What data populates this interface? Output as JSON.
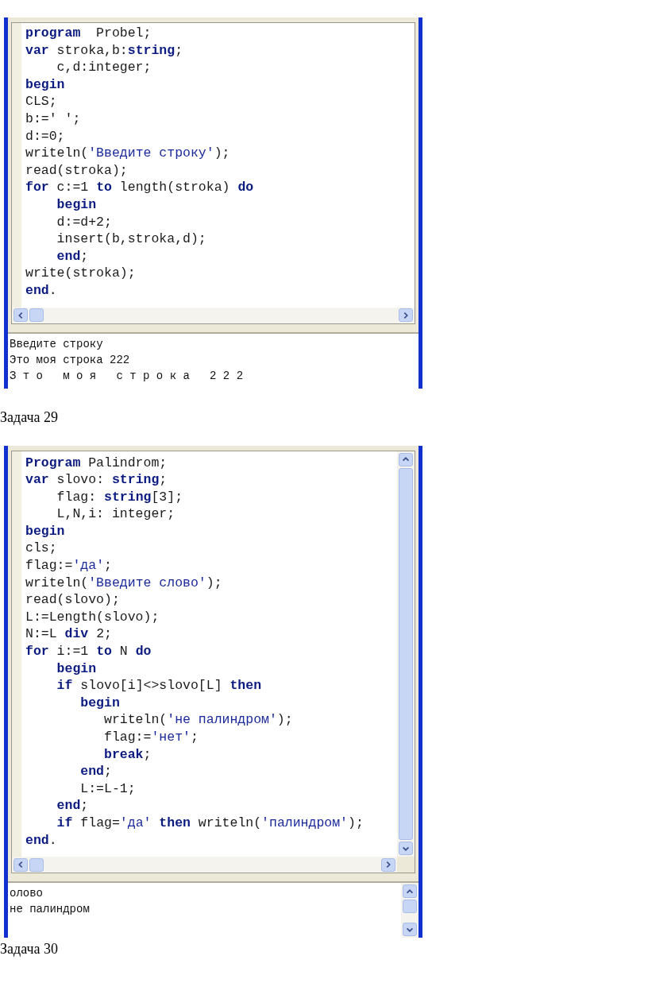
{
  "blocks": [
    {
      "editor": {
        "vertical_scrollbar": false,
        "lines": [
          [
            {
              "kind": "kw",
              "text": "program"
            },
            {
              "kind": "plain",
              "text": "  Probel;"
            }
          ],
          [
            {
              "kind": "kw",
              "text": "var"
            },
            {
              "kind": "plain",
              "text": " stroka,b:"
            },
            {
              "kind": "kw",
              "text": "string"
            },
            {
              "kind": "plain",
              "text": ";"
            }
          ],
          [
            {
              "kind": "plain",
              "text": "    c,d:integer;"
            }
          ],
          [
            {
              "kind": "kw",
              "text": "begin"
            }
          ],
          [
            {
              "kind": "plain",
              "text": "CLS;"
            }
          ],
          [
            {
              "kind": "plain",
              "text": "b:=' ';"
            }
          ],
          [
            {
              "kind": "plain",
              "text": "d:=0;"
            }
          ],
          [
            {
              "kind": "plain",
              "text": "writeln("
            },
            {
              "kind": "str",
              "text": "'Введите строку'"
            },
            {
              "kind": "plain",
              "text": ");"
            }
          ],
          [
            {
              "kind": "plain",
              "text": "read(stroka);"
            }
          ],
          [
            {
              "kind": "kw",
              "text": "for"
            },
            {
              "kind": "plain",
              "text": " c:=1 "
            },
            {
              "kind": "kw",
              "text": "to"
            },
            {
              "kind": "plain",
              "text": " length(stroka) "
            },
            {
              "kind": "kw",
              "text": "do"
            }
          ],
          [
            {
              "kind": "kw",
              "text": "    begin"
            }
          ],
          [
            {
              "kind": "plain",
              "text": "    d:=d+2;"
            }
          ],
          [
            {
              "kind": "plain",
              "text": "    insert(b,stroka,d);"
            }
          ],
          [
            {
              "kind": "kw",
              "text": "    end"
            },
            {
              "kind": "plain",
              "text": ";"
            }
          ],
          [
            {
              "kind": "plain",
              "text": "write(stroka);"
            }
          ],
          [
            {
              "kind": "kw",
              "text": "end"
            },
            {
              "kind": "plain",
              "text": "."
            }
          ]
        ]
      },
      "output": {
        "vertical_scrollbar": false,
        "lines": [
          "Введите строку",
          "Это моя строка 222",
          "З т о   м о я   с т р о к а   2 2 2"
        ]
      },
      "caption": "Задача 29"
    },
    {
      "editor": {
        "vertical_scrollbar": true,
        "lines": [
          [
            {
              "kind": "kw",
              "text": "Program"
            },
            {
              "kind": "plain",
              "text": " Palindrom;"
            }
          ],
          [
            {
              "kind": "kw",
              "text": "var"
            },
            {
              "kind": "plain",
              "text": " slovo: "
            },
            {
              "kind": "kw",
              "text": "string"
            },
            {
              "kind": "plain",
              "text": ";"
            }
          ],
          [
            {
              "kind": "plain",
              "text": "    flag: "
            },
            {
              "kind": "kw",
              "text": "string"
            },
            {
              "kind": "plain",
              "text": "[3];"
            }
          ],
          [
            {
              "kind": "plain",
              "text": "    L,N,i: integer;"
            }
          ],
          [
            {
              "kind": "kw",
              "text": "begin"
            }
          ],
          [
            {
              "kind": "plain",
              "text": "cls;"
            }
          ],
          [
            {
              "kind": "plain",
              "text": "flag:="
            },
            {
              "kind": "str",
              "text": "'да'"
            },
            {
              "kind": "plain",
              "text": ";"
            }
          ],
          [
            {
              "kind": "plain",
              "text": "writeln("
            },
            {
              "kind": "str",
              "text": "'Введите слово'"
            },
            {
              "kind": "plain",
              "text": ");"
            }
          ],
          [
            {
              "kind": "plain",
              "text": "read(slovo);"
            }
          ],
          [
            {
              "kind": "plain",
              "text": "L:=Length(slovo);"
            }
          ],
          [
            {
              "kind": "plain",
              "text": "N:=L "
            },
            {
              "kind": "kw",
              "text": "div"
            },
            {
              "kind": "plain",
              "text": " 2;"
            }
          ],
          [
            {
              "kind": "kw",
              "text": "for"
            },
            {
              "kind": "plain",
              "text": " i:=1 "
            },
            {
              "kind": "kw",
              "text": "to"
            },
            {
              "kind": "plain",
              "text": " N "
            },
            {
              "kind": "kw",
              "text": "do"
            }
          ],
          [
            {
              "kind": "kw",
              "text": "    begin"
            }
          ],
          [
            {
              "kind": "kw",
              "text": "    if"
            },
            {
              "kind": "plain",
              "text": " slovo[i]<>slovo[L] "
            },
            {
              "kind": "kw",
              "text": "then"
            }
          ],
          [
            {
              "kind": "kw",
              "text": "       begin"
            }
          ],
          [
            {
              "kind": "plain",
              "text": "          writeln("
            },
            {
              "kind": "str",
              "text": "'не палиндром'"
            },
            {
              "kind": "plain",
              "text": ");"
            }
          ],
          [
            {
              "kind": "plain",
              "text": "          flag:="
            },
            {
              "kind": "str",
              "text": "'нет'"
            },
            {
              "kind": "plain",
              "text": ";"
            }
          ],
          [
            {
              "kind": "kw",
              "text": "          break"
            },
            {
              "kind": "plain",
              "text": ";"
            }
          ],
          [
            {
              "kind": "kw",
              "text": "       end"
            },
            {
              "kind": "plain",
              "text": ";"
            }
          ],
          [
            {
              "kind": "plain",
              "text": "       L:=L-1;"
            }
          ],
          [
            {
              "kind": "kw",
              "text": "    end"
            },
            {
              "kind": "plain",
              "text": ";"
            }
          ],
          [
            {
              "kind": "kw",
              "text": "    if"
            },
            {
              "kind": "plain",
              "text": " flag="
            },
            {
              "kind": "str",
              "text": "'да'"
            },
            {
              "kind": "kw",
              "text": " then"
            },
            {
              "kind": "plain",
              "text": " writeln("
            },
            {
              "kind": "str",
              "text": "'палиндром'"
            },
            {
              "kind": "plain",
              "text": ");"
            }
          ],
          [
            {
              "kind": "kw",
              "text": "end"
            },
            {
              "kind": "plain",
              "text": "."
            }
          ]
        ]
      },
      "output": {
        "vertical_scrollbar": true,
        "lines": [
          "олово",
          "не палиндром"
        ]
      },
      "caption": "Задача 30"
    }
  ]
}
